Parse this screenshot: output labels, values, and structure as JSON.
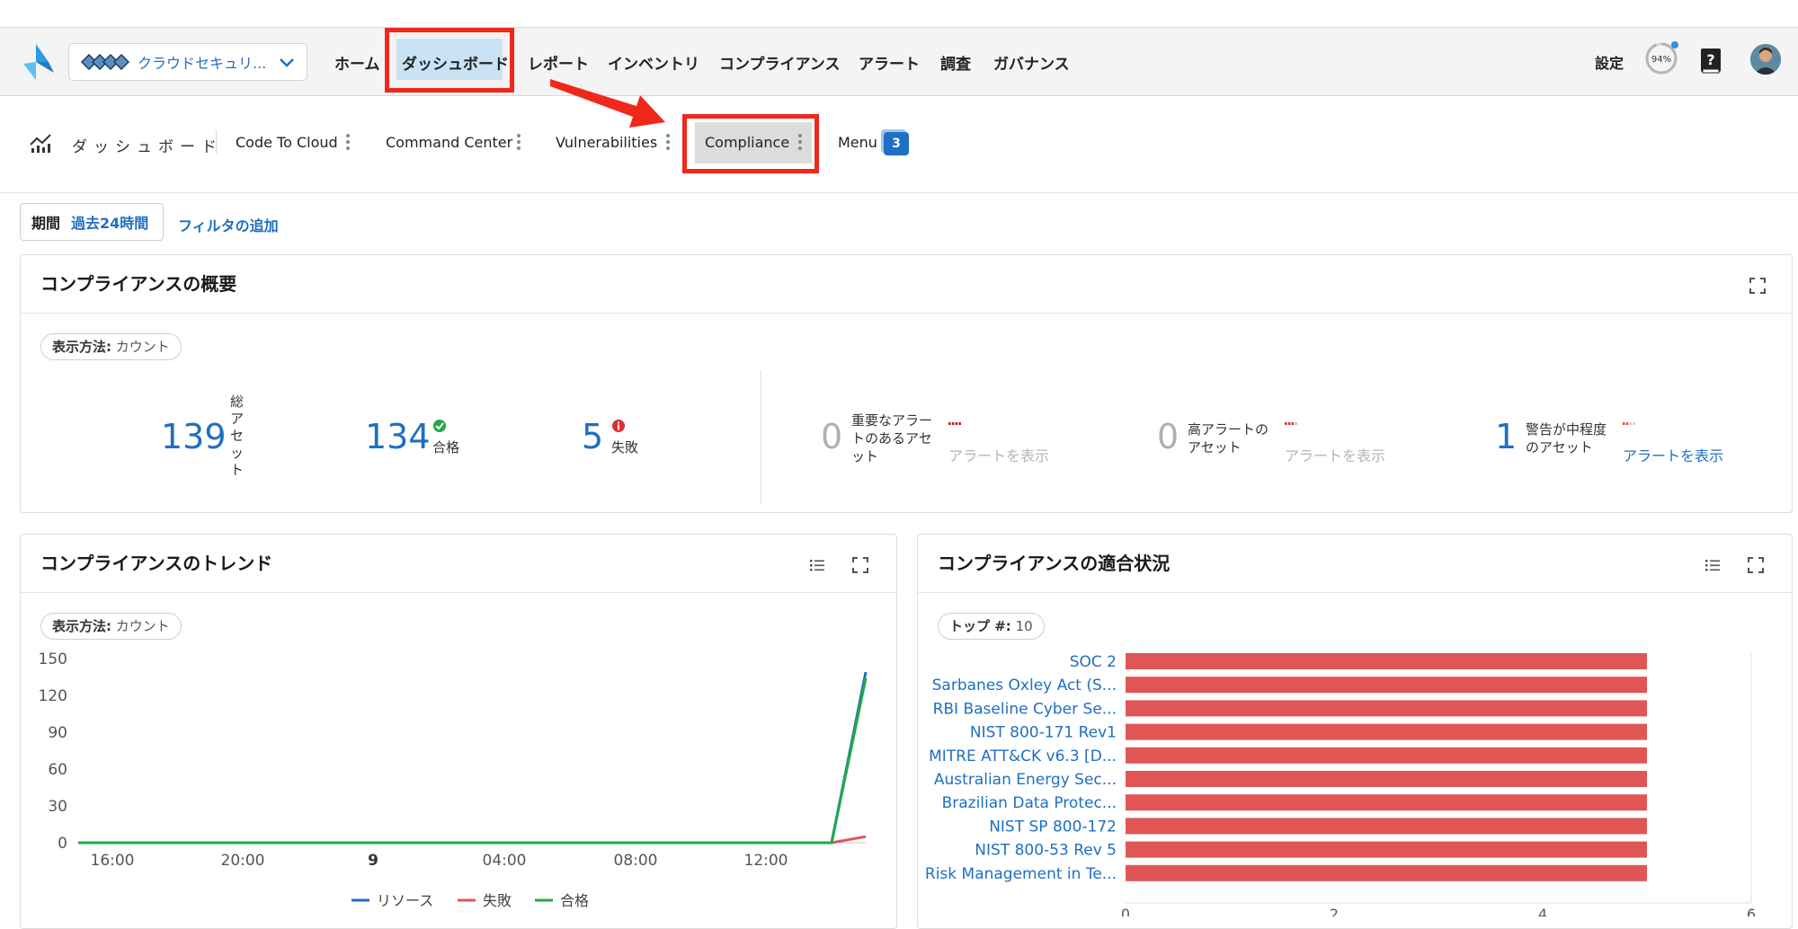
{
  "topnav": {
    "tenant_name": "クラウドセキュリ...",
    "items": [
      "ホーム",
      "ダッシュボード",
      "レポート",
      "インベントリ",
      "コンプライアンス",
      "アラート",
      "調査",
      "ガバナンス"
    ],
    "settings": "設定",
    "progress": "94%"
  },
  "dashboard": {
    "label": "ダッシュボード",
    "tabs": [
      "Code To Cloud",
      "Command Center",
      "Vulnerabilities",
      "Compliance"
    ],
    "menu_label": "Menu",
    "menu_badge": "3"
  },
  "filter": {
    "period_key": "期間",
    "period_value": "過去24時間",
    "add_filter": "フィルタの追加"
  },
  "overview": {
    "title": "コンプライアンスの概要",
    "display_key": "表示方法:",
    "display_value": "カウント",
    "total_value": "139",
    "total_label": "総アセット",
    "pass_value": "134",
    "pass_label": "合格",
    "fail_value": "5",
    "fail_label": "失敗",
    "alerts": [
      {
        "count": "0",
        "label": "重要なアラートのあるアセット",
        "link": "アラートを表示",
        "active": false
      },
      {
        "count": "0",
        "label": "高アラートのアセット",
        "link": "アラートを表示",
        "active": false
      },
      {
        "count": "1",
        "label": "警告が中程度のアセット",
        "link": "アラートを表示",
        "active": true
      }
    ]
  },
  "trend": {
    "title": "コンプライアンスのトレンド",
    "display_key": "表示方法:",
    "display_value": "カウント"
  },
  "conformance": {
    "title": "コンプライアンスの適合状況",
    "top_key": "トップ #:",
    "top_value": "10"
  },
  "colors": {
    "blue": "#1f6fc2",
    "red": "#e05555",
    "green": "#22a845",
    "highlight": "#f0281c"
  },
  "chart_data": [
    {
      "type": "line",
      "x": [
        "16:00",
        "20:00",
        "9",
        "04:00",
        "08:00",
        "12:00"
      ],
      "ylim": [
        0,
        150
      ],
      "yticks": [
        "150",
        "120",
        "90",
        "60",
        "30",
        "0"
      ],
      "series": [
        {
          "name": "リソース",
          "color": "#1f6fc2",
          "values": [
            0,
            0,
            0,
            0,
            0,
            0,
            139
          ]
        },
        {
          "name": "失敗",
          "color": "#e05555",
          "values": [
            0,
            0,
            0,
            0,
            0,
            0,
            5
          ]
        },
        {
          "name": "合格",
          "color": "#22a845",
          "values": [
            0,
            0,
            0,
            0,
            0,
            0,
            134
          ]
        }
      ],
      "grid": false,
      "legend": "bottom"
    },
    {
      "type": "bar",
      "orientation": "horizontal",
      "categories": [
        "SOC 2",
        "Sarbanes Oxley Act (S...",
        "RBI Baseline Cyber Se...",
        "NIST 800-171 Rev1",
        "MITRE ATT&CK v6.3 [D...",
        "Australian Energy Sec...",
        "Brazilian Data Protec...",
        "NIST SP 800-172",
        "NIST 800-53 Rev 5",
        "Risk Management in Te..."
      ],
      "values": [
        5,
        5,
        5,
        5,
        5,
        5,
        5,
        5,
        5,
        5
      ],
      "xlim": [
        0,
        6
      ],
      "xticks": [
        "0",
        "2",
        "4",
        "6"
      ],
      "color": "#e05555"
    }
  ]
}
